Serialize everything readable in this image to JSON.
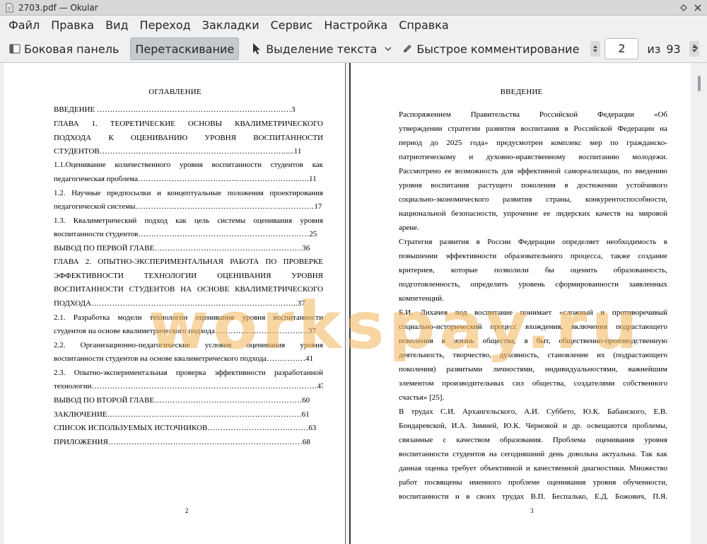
{
  "window": {
    "title": "2703.pdf  — Okular"
  },
  "menu": [
    "Файл",
    "Правка",
    "Вид",
    "Переход",
    "Закладки",
    "Сервис",
    "Настройка",
    "Справка"
  ],
  "toolbar": {
    "sidebar_label": "Боковая панель",
    "drag_label": "Перетаскивание",
    "select_label": "Выделение текста",
    "annotate_label": "Быстрое комментирование",
    "page_current": "2",
    "page_of": "из",
    "page_total": "93"
  },
  "left_page": {
    "heading": "ОГЛАВЛЕНИЕ",
    "lines": [
      "ВВЕДЕНИЕ …………………………………………………………………3",
      "ГЛАВА    1.    ТЕОРЕТИЧЕСКИЕ    ОСНОВЫ    КВАЛИМЕТРИЧЕСКОГО",
      "ПОДХОДА     К     ОЦЕНИВАНИЮ     УРОВНЯ     ВОСПИТАННОСТИ",
      "СТУДЕНТОВ………………………………………………………………....11",
      "  1.1.Оценивание количественного уровня воспитанности студентов как",
      "педагогическая проблема……………………………………………………...….11",
      "  1.2.    Научные предпосылки и концептуальные положения проектирования",
      "педагогической системы……………………………………………………………17",
      "  1.3.    Квалиметрический подход как цель системы оценивания уровня",
      "воспитанности студентов…………………………………………………………25",
      "ВЫВОД ПО ПЕРВОЙ ГЛАВЕ…………………………………………………36",
      "ГЛАВА   2.   ОПЫТНО-ЭКСПЕРИМЕНТАЛЬНАЯ   РАБОТА   ПО   ПРОВЕРКЕ",
      "ЭФФЕКТИВНОСТИ     ТЕХНОЛОГИИ     ОЦЕНИВАНИЯ     УРОВНЯ",
      "ВОСПИТАННОСТИ СТУДЕНТОВ НА ОСНОВЕ КВАЛИМЕТРИЧЕСКОГО",
      "ПОДХОДА……………………………………………………………………..37",
      "  2.1.  Разработка модели технологии оценивания уровня воспитанности",
      "студентов на основе квалиметрического подхода………………………………37",
      "  2.2.    Организационно-педагогические    условия    оценивания    уровня",
      "воспитанности студентов на основе квалиметрического подхода……………41",
      "  2.3.  Опытно-экспериментальная проверка эффективности разработанной",
      "технологии……………………………………………………………………………47",
      "ВЫВОД ПО ВТОРОЙ ГЛАВЕ…………………………………………………60",
      "ЗАКЛЮЧЕНИЕ…………………………………………………………………61",
      "СПИСОК ИСПОЛЬЗУЕМЫХ ИСТОЧНИКОВ…………………………………63",
      "ПРИЛОЖЕНИЯ…………………………………………………………………68"
    ],
    "page_number": "2"
  },
  "right_page": {
    "heading": "ВВЕДЕНИЕ",
    "lines": [
      "        Распоряжением    Правительства    Российской    Федерации    «Об",
      "утверждении стратегии развития воспитания в Российской Федерации на",
      "период до 2025 года» предусмотрен комплекс мер по гражданско-",
      "патриотическому и духовно-нравственному воспитанию молодежи.",
      "Рассмотрено ее возможность для эффективной самореализации, по введению",
      "уровня воспитания растущего поколения в достижении устойчивого",
      "социально-экономического развития страны, конкурентоспособности,",
      "национальной безопасности, упрочение ее лидерских качеств на мировой",
      "арене.",
      "        Стратегия развития в России Федерации определяет необходимость в",
      "повышении эффективности образовательного процесса, также создание",
      "критериев, которые позволили бы оценить образованность,",
      "подготовленность, определить уровень сформированности заявленных",
      "компетенций.",
      "        Б.И. Лихачев под воспитание понимает «сложный и противоречивый",
      "социально-исторический процесс вхождения, включения подрастающего",
      "поколения в жизнь общества, в быт, общественно-производственную",
      "деятельность, творчество, духовность, становление их (подрастающего",
      "поколения) развитыми личностями, индивидуальностями, важнейшим",
      "элементом производительных сил общества, создателями собственного",
      "счастья» [25].",
      "        В трудах С.И. Архангельского, А.И. Суббето, Ю.К. Бабанского, Е.В.",
      "Бондаревской, И.А. Зимней, Ю.К. Черновой и др. освещаются проблемы,",
      "связанные с качеством образования. Проблема оценивания уровня",
      "воспитанности студентов на сегодняшний день довольна актуальна. Так как",
      "данная оценка требует объективной и качественной диагностики. Множество",
      "работ посвящены именного проблеме оценивания уровня обученности,",
      "воспитанности и в своих трудах В.П. Беспалько, Е.Д. Божович, П.Я."
    ],
    "page_number": "3"
  },
  "watermark": "workspay.ru"
}
